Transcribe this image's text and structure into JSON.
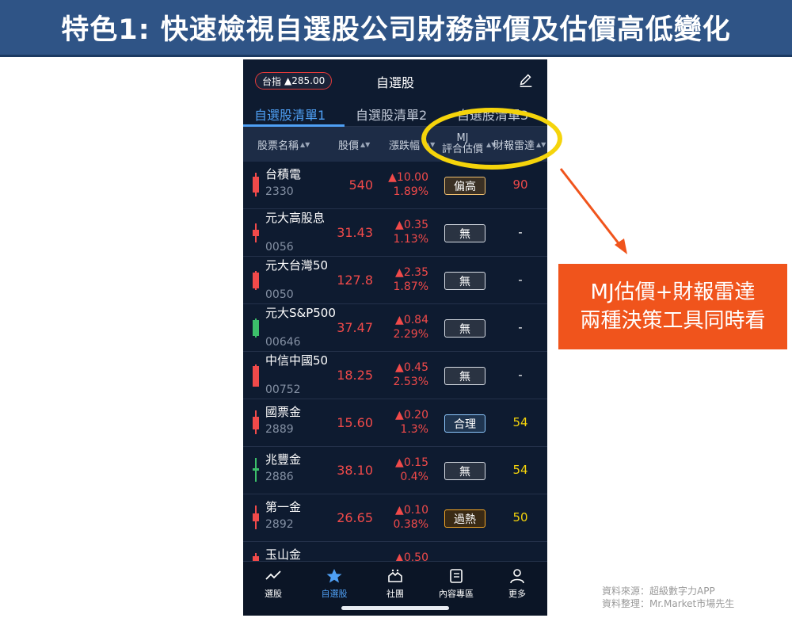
{
  "banner": {
    "title": "特色1: 快速檢視自選股公司財務評價及估價高低變化"
  },
  "app": {
    "index_label": "台指",
    "index_value": "▲285.00",
    "title": "自選股",
    "tabs": [
      {
        "label": "自選股清單1"
      },
      {
        "label": "自選股清單2"
      },
      {
        "label": "自選股清單3"
      }
    ],
    "columns": {
      "name": "股票名稱",
      "price": "股價",
      "change": "漲跌幅",
      "mj_line1": "MJ",
      "mj_line2": "評合估價",
      "radar": "財報雷達"
    },
    "rows": [
      {
        "name": "台積電",
        "code": "2330",
        "price": "540",
        "change": "▲10.00",
        "pct": "1.89%",
        "mj": "偏高",
        "radar": "90"
      },
      {
        "name": "元大高股息",
        "code": "0056",
        "price": "31.43",
        "change": "▲0.35",
        "pct": "1.13%",
        "mj": "無",
        "radar": "-"
      },
      {
        "name": "元大台灣50",
        "code": "0050",
        "price": "127.8",
        "change": "▲2.35",
        "pct": "1.87%",
        "mj": "無",
        "radar": "-"
      },
      {
        "name": "元大S&P500",
        "code": "00646",
        "price": "37.47",
        "change": "▲0.84",
        "pct": "2.29%",
        "mj": "無",
        "radar": "-"
      },
      {
        "name": "中信中國50",
        "code": "00752",
        "price": "18.25",
        "change": "▲0.45",
        "pct": "2.53%",
        "mj": "無",
        "radar": "-"
      },
      {
        "name": "國票金",
        "code": "2889",
        "price": "15.60",
        "change": "▲0.20",
        "pct": "1.3%",
        "mj": "合理",
        "radar": "54"
      },
      {
        "name": "兆豐金",
        "code": "2886",
        "price": "38.10",
        "change": "▲0.15",
        "pct": "0.4%",
        "mj": "無",
        "radar": "54"
      },
      {
        "name": "第一金",
        "code": "2892",
        "price": "26.65",
        "change": "▲0.10",
        "pct": "0.38%",
        "mj": "過熱",
        "radar": "50"
      },
      {
        "name": "玉山金",
        "code": "",
        "price": "",
        "change": "▲0.50",
        "pct": "",
        "mj": "",
        "radar": ""
      }
    ],
    "tabbar": [
      {
        "label": "選股",
        "icon": "chart-line-icon"
      },
      {
        "label": "自選股",
        "icon": "star-icon"
      },
      {
        "label": "社團",
        "icon": "community-icon"
      },
      {
        "label": "內容專區",
        "icon": "content-icon"
      },
      {
        "label": "更多",
        "icon": "person-icon"
      }
    ]
  },
  "callout": {
    "line1": "MJ估價+財報雷達",
    "line2": "兩種決策工具同時看"
  },
  "source": {
    "line1": "資料來源：超級數字力APP",
    "line2": "資料整理：Mr.Market市場先生"
  },
  "colors": {
    "banner": "#2f5486",
    "app_bg": "#0e1b30",
    "header_bg": "#1d2c46",
    "up_red": "#f14a4a",
    "accent_blue": "#4fa0f5",
    "highlight_yellow": "#f5d40b",
    "callout_orange": "#f0541c",
    "badge_high": "#f0c070",
    "badge_none": "#d8dde5",
    "badge_fair": "#8ec9ff",
    "badge_hot": "#f5a623",
    "radar_red": "#f14a4a",
    "radar_yellow": "#f5d40b"
  }
}
